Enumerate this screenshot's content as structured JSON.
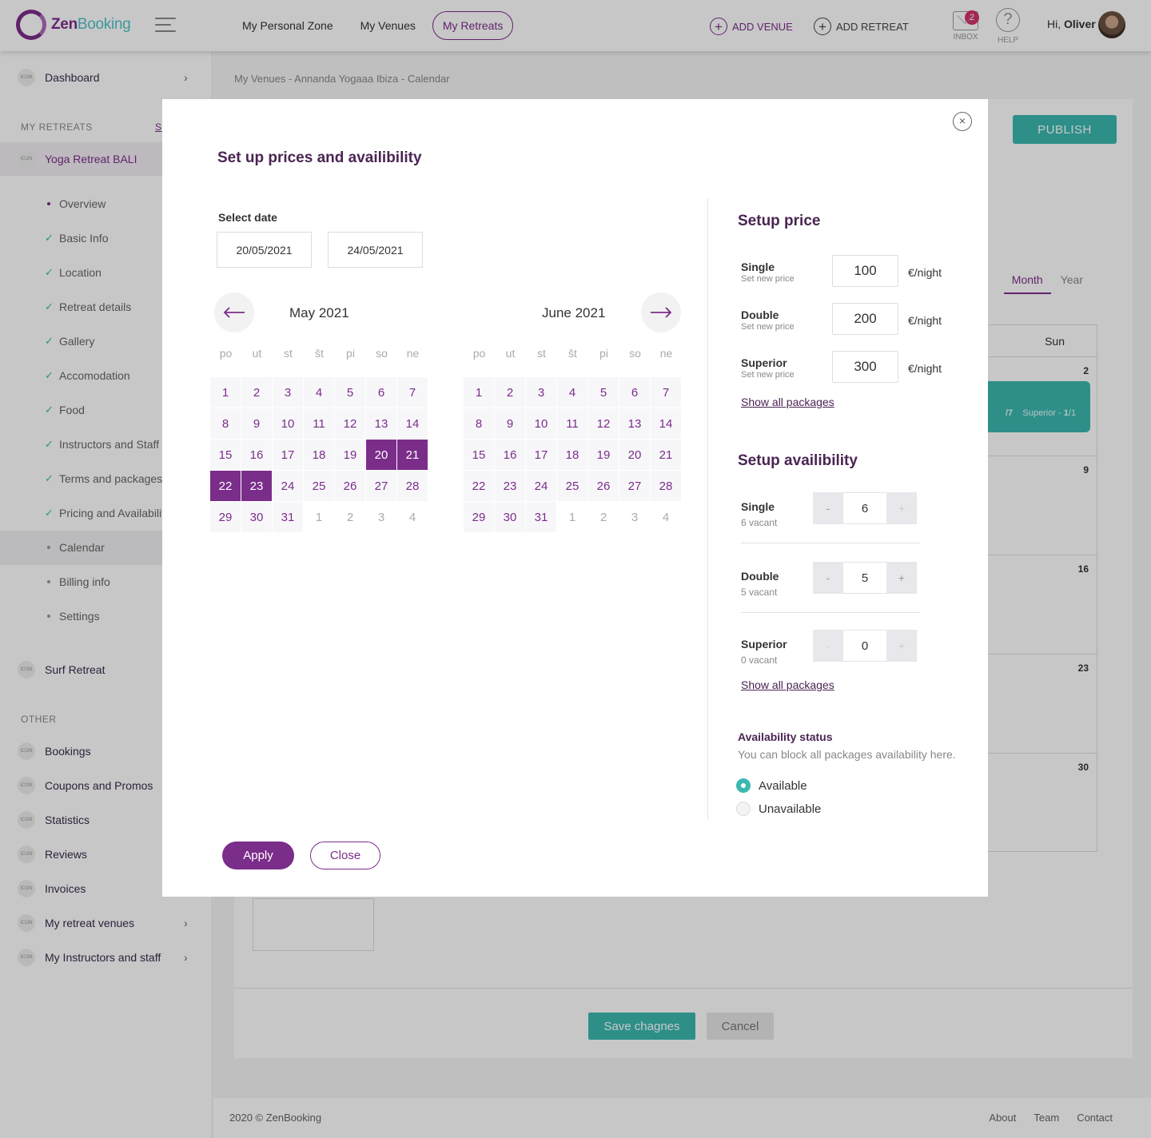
{
  "brand": {
    "name_part1": "Zen",
    "name_part2": "Booking"
  },
  "topnav": {
    "items": [
      {
        "label": "My Personal Zone"
      },
      {
        "label": "My Venues"
      },
      {
        "label": "My Retreats"
      }
    ],
    "add_venue": "ADD VENUE",
    "add_retreat": "ADD RETREAT",
    "inbox_label": "INBOX",
    "inbox_count": "2",
    "help_label": "HELP",
    "help_glyph": "?",
    "greeting": "Hi,",
    "user_name": "Oliver"
  },
  "sidebar": {
    "icon_text": "ICON",
    "dashboard": "Dashboard",
    "my_retreats_header": "MY RETREATS",
    "my_retreats_link": "S",
    "active_retreat": "Yoga Retreat BALI",
    "subitems": [
      {
        "label": "Overview",
        "status": "dot"
      },
      {
        "label": "Basic Info",
        "status": "check"
      },
      {
        "label": "Location",
        "status": "check"
      },
      {
        "label": "Retreat details",
        "status": "check"
      },
      {
        "label": "Gallery",
        "status": "check"
      },
      {
        "label": "Accomodation",
        "status": "check"
      },
      {
        "label": "Food",
        "status": "check"
      },
      {
        "label": "Instructors and Staff",
        "status": "check"
      },
      {
        "label": "Terms and packages",
        "status": "check"
      },
      {
        "label": "Pricing and Availability",
        "status": "check"
      },
      {
        "label": "Calendar",
        "status": "dot"
      },
      {
        "label": "Billing info",
        "status": "dot"
      },
      {
        "label": "Settings",
        "status": "dot"
      }
    ],
    "surf_retreat": "Surf Retreat",
    "other_header": "OTHER",
    "other_items": [
      {
        "label": "Bookings"
      },
      {
        "label": "Coupons and Promos"
      },
      {
        "label": "Statistics"
      },
      {
        "label": "Reviews"
      },
      {
        "label": "Invoices"
      },
      {
        "label": "My retreat venues"
      },
      {
        "label": "My Instructors and staff"
      }
    ]
  },
  "main": {
    "breadcrumb": "My Venues - Annanda Yogaaa Ibiza - Calendar",
    "publish": "PUBLISH",
    "tab_month": "Month",
    "tab_year": "Year",
    "col_sun": "Sun",
    "days": [
      "2",
      "9",
      "16",
      "23",
      "30"
    ],
    "booking_text_a": "/7",
    "booking_text_b": "Superior - ",
    "booking_text_c": "1",
    "booking_text_d": "/1",
    "save": "Save chagnes",
    "cancel": "Cancel"
  },
  "footer": {
    "copyright": "2020 © ZenBooking",
    "links": [
      "About",
      "Team",
      "Contact"
    ]
  },
  "modal": {
    "title": "Set up prices and availibility",
    "select_date": "Select date",
    "date_from": "20/05/2021",
    "date_to": "24/05/2021",
    "weekday_labels": [
      "po",
      "ut",
      "st",
      "št",
      "pi",
      "so",
      "ne"
    ],
    "months": [
      {
        "title": "May 2021",
        "weeks": [
          [
            "1",
            "2",
            "3",
            "4",
            "5",
            "6",
            "7"
          ],
          [
            "8",
            "9",
            "10",
            "11",
            "12",
            "13",
            "14"
          ],
          [
            "15",
            "16",
            "17",
            "18",
            "19",
            "20",
            "21"
          ],
          [
            "22",
            "23",
            "24",
            "25",
            "26",
            "27",
            "28"
          ],
          [
            "29",
            "30",
            "31",
            "1",
            "2",
            "3",
            "4"
          ]
        ],
        "selected": [
          "20",
          "21",
          "22",
          "23"
        ],
        "muted_from_week5_index": 3
      },
      {
        "title": "June 2021",
        "weeks": [
          [
            "1",
            "2",
            "3",
            "4",
            "5",
            "6",
            "7"
          ],
          [
            "8",
            "9",
            "10",
            "11",
            "12",
            "13",
            "14"
          ],
          [
            "15",
            "16",
            "17",
            "18",
            "19",
            "20",
            "21"
          ],
          [
            "22",
            "23",
            "24",
            "25",
            "26",
            "27",
            "28"
          ],
          [
            "29",
            "30",
            "31",
            "1",
            "2",
            "3",
            "4"
          ]
        ],
        "selected": [],
        "muted_from_week5_index": 3
      }
    ],
    "setup_price": "Setup price",
    "prices": [
      {
        "name": "Single",
        "sub": "Set new price",
        "value": "100",
        "unit": "€/night"
      },
      {
        "name": "Double",
        "sub": "Set new price",
        "value": "200",
        "unit": "€/night"
      },
      {
        "name": "Superior",
        "sub": "Set new price",
        "value": "300",
        "unit": "€/night"
      }
    ],
    "show_all": "Show all packages",
    "setup_availability": "Setup availibility",
    "availability": [
      {
        "name": "Single",
        "sub": "6 vacant",
        "value": "6"
      },
      {
        "name": "Double",
        "sub": "5 vacant",
        "value": "5"
      },
      {
        "name": "Superior",
        "sub": "0 vacant",
        "value": "0"
      }
    ],
    "minus": "-",
    "plus": "+",
    "status_title": "Availability status",
    "status_sub": "You can block all packages availability here.",
    "status_available": "Available",
    "status_unavailable": "Unavailable",
    "apply": "Apply",
    "close": "Close",
    "close_glyph": "×"
  },
  "colors": {
    "purple": "#7b2d8a",
    "teal": "#3cb8b0",
    "dark_purple": "#4a2552"
  }
}
